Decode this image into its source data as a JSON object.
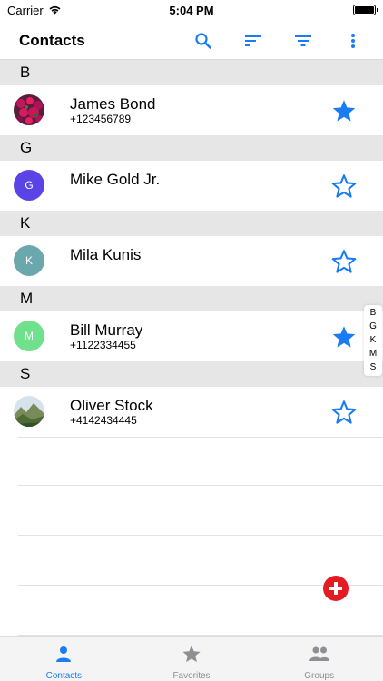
{
  "status_bar": {
    "carrier": "Carrier",
    "time": "5:04 PM"
  },
  "header": {
    "title": "Contacts"
  },
  "colors": {
    "accent": "#1a7cf5",
    "fab": "#e31b23",
    "section_bg": "#e6e6e6",
    "tab_inactive": "#8e8e93"
  },
  "sections": [
    {
      "letter": "B",
      "contacts": [
        {
          "name": "James Bond",
          "phone": "+123456789",
          "favorite": true,
          "avatar": "photo-flowers"
        }
      ]
    },
    {
      "letter": "G",
      "contacts": [
        {
          "name": "Mike Gold Jr.",
          "phone": "",
          "favorite": false,
          "avatar_initial": "G",
          "avatar_color": "#5a44e8"
        }
      ]
    },
    {
      "letter": "K",
      "contacts": [
        {
          "name": "Mila Kunis",
          "phone": "",
          "favorite": false,
          "avatar_initial": "K",
          "avatar_color": "#6aa8ae"
        }
      ]
    },
    {
      "letter": "M",
      "contacts": [
        {
          "name": "Bill Murray",
          "phone": "+1122334455",
          "favorite": true,
          "avatar_initial": "M",
          "avatar_color": "#6fe08c"
        }
      ]
    },
    {
      "letter": "S",
      "contacts": [
        {
          "name": "Oliver Stock",
          "phone": "+4142434445",
          "favorite": false,
          "avatar": "photo-landscape"
        }
      ]
    }
  ],
  "index_letters": [
    "B",
    "G",
    "K",
    "M",
    "S"
  ],
  "tabs": [
    {
      "label": "Contacts",
      "icon": "person-icon",
      "active": true
    },
    {
      "label": "Favorites",
      "icon": "star-icon",
      "active": false
    },
    {
      "label": "Groups",
      "icon": "people-icon",
      "active": false
    }
  ]
}
